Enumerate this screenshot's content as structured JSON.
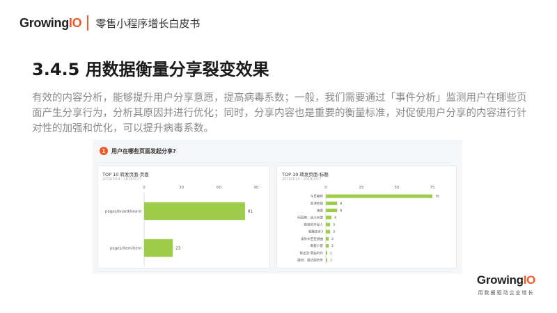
{
  "header": {
    "logo_main": "Growing",
    "logo_accent": "IO",
    "title": "零售小程序增长白皮书"
  },
  "page_title": "3.4.5 用数据衡量分享裂变效果",
  "body_text": "有效的内容分析，能够提升用户分享意愿，提高病毒系数；一般，我们需要通过「事件分析」监测用户在哪些页面产生分享行为，分析其原因并进行优化；同时，分享内容也是重要的衡量标准，对促使用户分享的内容进行针对性的加强和优化，可以提升病毒系数。",
  "panel": {
    "question_number": "1",
    "question": "用户在哪些页面发起分享?"
  },
  "footer": {
    "logo_main": "Growing",
    "logo_accent": "IO",
    "tagline": "用数据驱动企业增长"
  },
  "colors": {
    "accent": "#f0592a",
    "bar": "#9ccc4a"
  },
  "chart_data": [
    {
      "type": "bar",
      "orientation": "horizontal",
      "title": "TOP 10 转发页面-页面",
      "subtitle": "2019/3/14 - 2019/3/27",
      "categories": [
        "pages/board/board",
        "pages/item/item"
      ],
      "values": [
        81,
        23
      ],
      "xlim": [
        0,
        90
      ],
      "ticks": [
        0,
        30,
        60,
        90
      ]
    },
    {
      "type": "bar",
      "orientation": "horizontal",
      "title": "TOP 10 转发页面-标题",
      "subtitle": "2019/3/14 - 2019/3/27",
      "categories": [
        "今日推荐",
        "高清地铺",
        "油画",
        "阿丽塔：战斗天使",
        "疯狂的外星人",
        "驱魔高手3",
        "误杀水至狂想曲",
        "断裂少冒",
        "熊出没·原始时代",
        "康宿：逮达厨房舟"
      ],
      "values": [
        75,
        8,
        8,
        4,
        3,
        3,
        2,
        2,
        1,
        1
      ],
      "xlim": [
        0,
        75
      ],
      "ticks": [
        0,
        25,
        50,
        75
      ]
    }
  ]
}
